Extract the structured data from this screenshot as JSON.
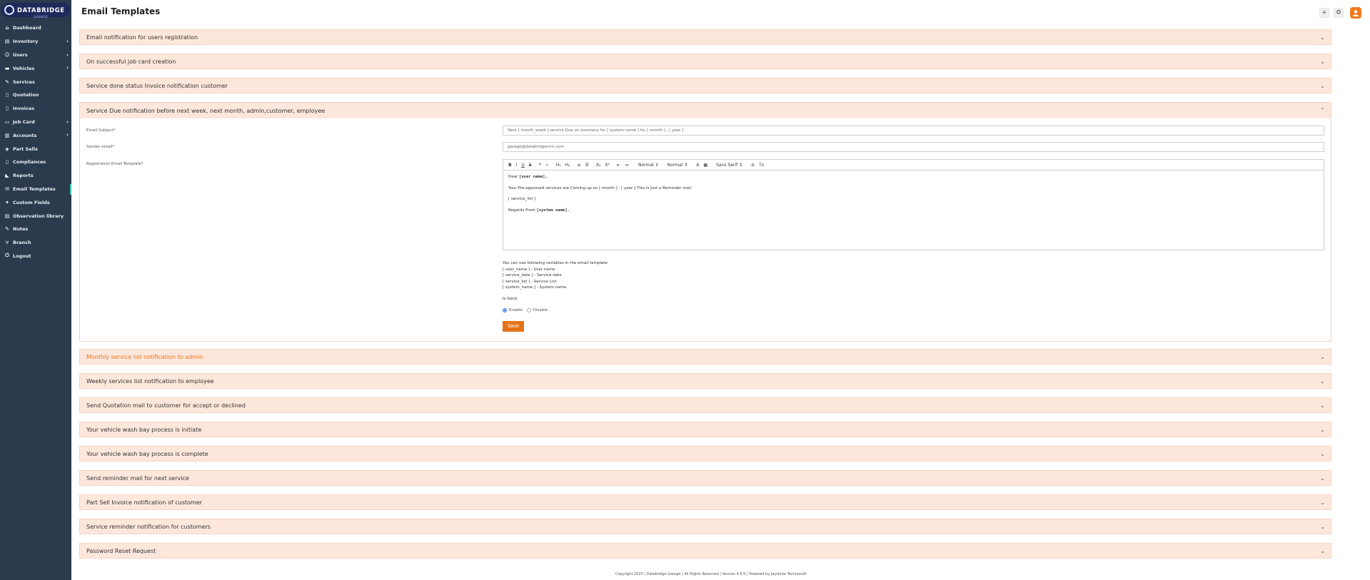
{
  "logo": {
    "brand": "DATABRIDGE",
    "sub": "GARAGE"
  },
  "sidebar": {
    "items": [
      {
        "label": "Dashboard",
        "icon": "home-icon",
        "glyph": "⌂",
        "has_arrow": false
      },
      {
        "label": "Inventory",
        "icon": "inventory-icon",
        "glyph": "▤",
        "has_arrow": true
      },
      {
        "label": "Users",
        "icon": "user-icon",
        "glyph": "☺",
        "has_arrow": true
      },
      {
        "label": "Vehicles",
        "icon": "car-icon",
        "glyph": "▬",
        "has_arrow": true
      },
      {
        "label": "Services",
        "icon": "wrench-icon",
        "glyph": "✎",
        "has_arrow": false
      },
      {
        "label": "Quotation",
        "icon": "file-icon",
        "glyph": "▯",
        "has_arrow": false
      },
      {
        "label": "Invoices",
        "icon": "invoice-icon",
        "glyph": "▯",
        "has_arrow": false
      },
      {
        "label": "Job Card",
        "icon": "card-icon",
        "glyph": "▭",
        "has_arrow": true
      },
      {
        "label": "Accounts",
        "icon": "accounts-icon",
        "glyph": "▥",
        "has_arrow": true
      },
      {
        "label": "Part Sells",
        "icon": "parts-icon",
        "glyph": "◈",
        "has_arrow": false
      },
      {
        "label": "Compliances",
        "icon": "compliance-icon",
        "glyph": "▯",
        "has_arrow": false
      },
      {
        "label": "Reports",
        "icon": "chart-icon",
        "glyph": "◣",
        "has_arrow": false
      },
      {
        "label": "Email Templates",
        "icon": "mail-icon",
        "glyph": "✉",
        "has_arrow": false,
        "active": true
      },
      {
        "label": "Custom Fields",
        "icon": "fields-icon",
        "glyph": "✦",
        "has_arrow": false
      },
      {
        "label": "Observation library",
        "icon": "library-icon",
        "glyph": "▤",
        "has_arrow": false
      },
      {
        "label": "Notes",
        "icon": "notes-icon",
        "glyph": "✎",
        "has_arrow": false
      },
      {
        "label": "Branch",
        "icon": "branch-icon",
        "glyph": "⑂",
        "has_arrow": false
      },
      {
        "label": "Logout",
        "icon": "power-icon",
        "glyph": "⏻",
        "has_arrow": false
      }
    ]
  },
  "header": {
    "title": "Email Templates",
    "add_glyph": "+",
    "settings_glyph": "⚙"
  },
  "accordions": {
    "top": [
      "Email notification for users registration",
      "On successful job card creation",
      "Service done status Invoice notification customer"
    ],
    "open_title": "Service Due notification before next week, next month, admin,customer, employee",
    "bottom": [
      "Monthly service list notification to admin",
      "Weekly services list notification to employee",
      "Send Quotation mail to customer for accept or declined",
      "Your vehicle wash bay process is initiate",
      "Your vehicle wash bay process is complete",
      "Send reminder mail for next service",
      "Part Sell Invoice notification of customer",
      "Service reminder notification for customers",
      "Password Reset Request"
    ],
    "chevron_down": "⌄",
    "chevron_up": "⌃"
  },
  "form": {
    "subject_label": "Email Subject*",
    "subject_value": "Next [ month_week ] service Due on summery for [ system name ] for [ month ] - [ year ] .",
    "sender_label": "Sender email*",
    "sender_value": "garage@databridgecrm.com",
    "template_label": "Registration Email Template*",
    "toolbar": {
      "bold": "B",
      "italic": "I",
      "underline": "U",
      "strike": "S",
      "quote": "❝",
      "code": "‹›",
      "h1": "H₁",
      "h2": "H₂",
      "ol": "≡",
      "ul": "☰",
      "sub": "X₂",
      "sup": "X²",
      "indent_less": "⇤",
      "indent_more": "⇥",
      "size": "Normal ⇕",
      "heading": "Normal ⇕",
      "color": "A",
      "bg": "▦",
      "font": "Sans Serif ⇕",
      "link": "⊘",
      "clean": "Tx"
    },
    "editor": {
      "dear": "Dear",
      "dear_var": "[user name],",
      "line2": "Your Pre-approved services are Coming up on [ month ] - [ year ] This is Just a Reminder mail.",
      "line3": "[ service_list ]",
      "regards": "Regards From",
      "regards_var": "[system name]."
    },
    "vars_title": "You can use following variables in the email template",
    "vars": [
      "[ user_name ] - User name",
      "[ service_date ] - Service date",
      "[ service_list ] - Service List",
      "[ system_name ] - System name"
    ],
    "is_send_label": "Is Send",
    "enable_label": "Enable",
    "disable_label": "Disable",
    "selected": "Enable",
    "save_label": "Save"
  },
  "footer": "Copyright 2025 | Databridge Garage | All Rights Reserved | Version 4.6.5 | Powered by Jayshree Technosoft",
  "colors": {
    "sidebar_bg": "#2b3a4d",
    "accent": "#e5731a",
    "accordion_bg": "#fde7dc"
  }
}
